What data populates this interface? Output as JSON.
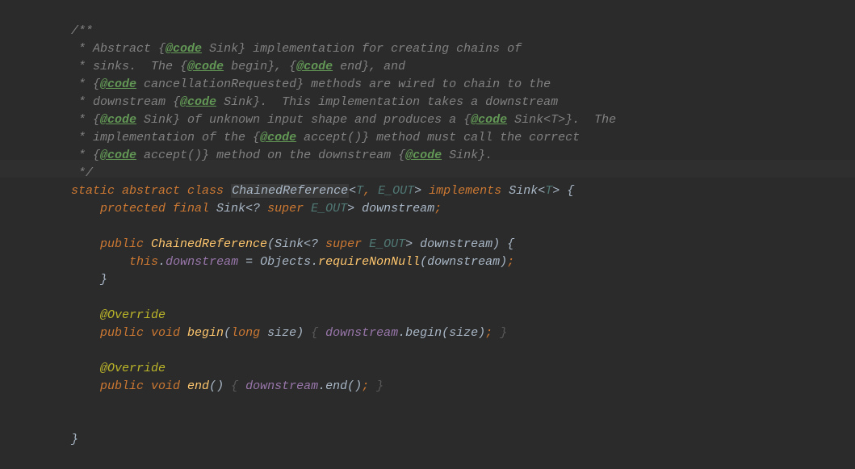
{
  "code": {
    "lines": [
      {
        "indent": 1,
        "tokens": [
          {
            "c": "comment",
            "t": "/**"
          }
        ]
      },
      {
        "indent": 1,
        "tokens": [
          {
            "c": "comment",
            "t": " * Abstract {"
          },
          {
            "c": "doc-tag",
            "t": "@code"
          },
          {
            "c": "comment",
            "t": " Sink} implementation for creating chains of"
          }
        ]
      },
      {
        "indent": 1,
        "tokens": [
          {
            "c": "comment",
            "t": " * sinks.  The {"
          },
          {
            "c": "doc-tag",
            "t": "@code"
          },
          {
            "c": "comment",
            "t": " begin}, {"
          },
          {
            "c": "doc-tag",
            "t": "@code"
          },
          {
            "c": "comment",
            "t": " end}, and"
          }
        ]
      },
      {
        "indent": 1,
        "tokens": [
          {
            "c": "comment",
            "t": " * {"
          },
          {
            "c": "doc-tag",
            "t": "@code"
          },
          {
            "c": "comment",
            "t": " cancellationRequested} methods are wired to chain to the"
          }
        ]
      },
      {
        "indent": 1,
        "tokens": [
          {
            "c": "comment",
            "t": " * downstream {"
          },
          {
            "c": "doc-tag",
            "t": "@code"
          },
          {
            "c": "comment",
            "t": " Sink}.  This implementation takes a downstream"
          }
        ]
      },
      {
        "indent": 1,
        "tokens": [
          {
            "c": "comment",
            "t": " * {"
          },
          {
            "c": "doc-tag",
            "t": "@code"
          },
          {
            "c": "comment",
            "t": " Sink} of unknown input shape and produces a {"
          },
          {
            "c": "doc-tag",
            "t": "@code"
          },
          {
            "c": "comment",
            "t": " Sink<T>}.  The"
          }
        ]
      },
      {
        "indent": 1,
        "tokens": [
          {
            "c": "comment",
            "t": " * implementation of the {"
          },
          {
            "c": "doc-tag",
            "t": "@code"
          },
          {
            "c": "comment",
            "t": " accept()} method must call the correct"
          }
        ]
      },
      {
        "indent": 1,
        "tokens": [
          {
            "c": "comment",
            "t": " * {"
          },
          {
            "c": "doc-tag",
            "t": "@code"
          },
          {
            "c": "comment",
            "t": " accept()} method on the downstream {"
          },
          {
            "c": "doc-tag",
            "t": "@code"
          },
          {
            "c": "comment",
            "t": " Sink}."
          }
        ]
      },
      {
        "indent": 1,
        "tokens": [
          {
            "c": "comment",
            "t": " */"
          }
        ]
      },
      {
        "indent": 1,
        "highlighted": true,
        "tokens": [
          {
            "c": "keyword",
            "t": "static abstract class "
          },
          {
            "c": "classname-def",
            "t": "ChainedReference"
          },
          {
            "c": "generic",
            "t": "<"
          },
          {
            "c": "type-param",
            "t": "T"
          },
          {
            "c": "semi",
            "t": ", "
          },
          {
            "c": "type-param",
            "t": "E_OUT"
          },
          {
            "c": "generic",
            "t": "> "
          },
          {
            "c": "keyword",
            "t": "implements "
          },
          {
            "c": "classname",
            "t": "Sink"
          },
          {
            "c": "generic",
            "t": "<"
          },
          {
            "c": "type-param",
            "t": "T"
          },
          {
            "c": "generic",
            "t": "> "
          },
          {
            "c": "default",
            "t": "{"
          }
        ]
      },
      {
        "indent": 2,
        "tokens": [
          {
            "c": "keyword",
            "t": "protected final "
          },
          {
            "c": "classname",
            "t": "Sink"
          },
          {
            "c": "generic",
            "t": "<? "
          },
          {
            "c": "keyword",
            "t": "super "
          },
          {
            "c": "type-param",
            "t": "E_OUT"
          },
          {
            "c": "generic",
            "t": "> "
          },
          {
            "c": "default",
            "t": "downstream"
          },
          {
            "c": "semi",
            "t": ";"
          }
        ]
      },
      {
        "indent": 0,
        "tokens": []
      },
      {
        "indent": 2,
        "tokens": [
          {
            "c": "keyword",
            "t": "public "
          },
          {
            "c": "method",
            "t": "ChainedReference"
          },
          {
            "c": "default",
            "t": "("
          },
          {
            "c": "classname",
            "t": "Sink"
          },
          {
            "c": "generic",
            "t": "<? "
          },
          {
            "c": "keyword",
            "t": "super "
          },
          {
            "c": "type-param",
            "t": "E_OUT"
          },
          {
            "c": "generic",
            "t": "> "
          },
          {
            "c": "default",
            "t": "downstream) {"
          }
        ]
      },
      {
        "indent": 3,
        "tokens": [
          {
            "c": "this-kw",
            "t": "this"
          },
          {
            "c": "default",
            "t": "."
          },
          {
            "c": "field",
            "t": "downstream"
          },
          {
            "c": "default",
            "t": " = Objects."
          },
          {
            "c": "method-static-italic",
            "t": "requireNonNull"
          },
          {
            "c": "default",
            "t": "(downstream)"
          },
          {
            "c": "semi",
            "t": ";"
          }
        ]
      },
      {
        "indent": 2,
        "tokens": [
          {
            "c": "default",
            "t": "}"
          }
        ]
      },
      {
        "indent": 0,
        "tokens": []
      },
      {
        "indent": 2,
        "tokens": [
          {
            "c": "annotation",
            "t": "@Override"
          }
        ]
      },
      {
        "indent": 2,
        "tokens": [
          {
            "c": "keyword",
            "t": "public void "
          },
          {
            "c": "method",
            "t": "begin"
          },
          {
            "c": "default",
            "t": "("
          },
          {
            "c": "keyword",
            "t": "long "
          },
          {
            "c": "default",
            "t": "size) "
          },
          {
            "c": "brace-dim",
            "t": "{ "
          },
          {
            "c": "field",
            "t": "downstream"
          },
          {
            "c": "default",
            "t": ".begin(size)"
          },
          {
            "c": "semi",
            "t": "; "
          },
          {
            "c": "brace-dim",
            "t": "}"
          }
        ]
      },
      {
        "indent": 0,
        "tokens": []
      },
      {
        "indent": 2,
        "tokens": [
          {
            "c": "annotation",
            "t": "@Override"
          }
        ]
      },
      {
        "indent": 2,
        "tokens": [
          {
            "c": "keyword",
            "t": "public void "
          },
          {
            "c": "method",
            "t": "end"
          },
          {
            "c": "default",
            "t": "() "
          },
          {
            "c": "brace-dim",
            "t": "{ "
          },
          {
            "c": "field",
            "t": "downstream"
          },
          {
            "c": "default",
            "t": ".end()"
          },
          {
            "c": "semi",
            "t": "; "
          },
          {
            "c": "brace-dim",
            "t": "}"
          }
        ]
      },
      {
        "indent": 0,
        "tokens": []
      },
      {
        "indent": 0,
        "tokens": []
      },
      {
        "indent": 1,
        "tokens": [
          {
            "c": "default",
            "t": "}"
          }
        ]
      }
    ]
  },
  "indentUnit": "    "
}
